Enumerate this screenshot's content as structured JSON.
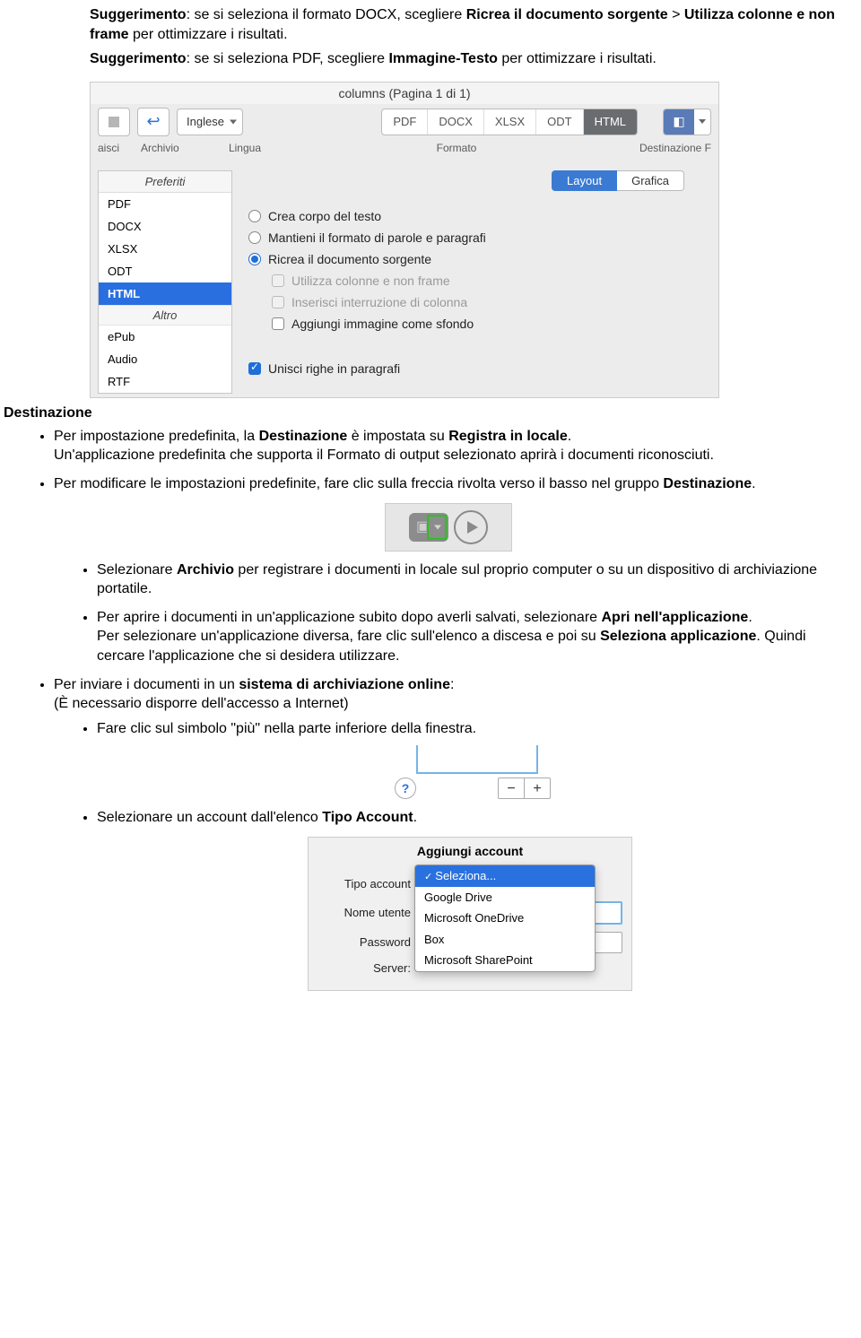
{
  "tips": {
    "tip1_label": "Suggerimento",
    "tip1_part1": ": se si seleziona il formato DOCX, scegliere ",
    "tip1_bold1": "Ricrea il documento sorgente",
    "tip1_part2": " > ",
    "tip1_bold2": "Utilizza colonne e non frame",
    "tip1_part3": " per ottimizzare i risultati.",
    "tip2_label": "Suggerimento",
    "tip2_part1": ": se si seleziona PDF, scegliere ",
    "tip2_bold1": "Immagine-Testo",
    "tip2_part2": " per ottimizzare i risultati."
  },
  "shot1": {
    "title": "columns (Pagina 1 di 1)",
    "lang": "Inglese",
    "formats": [
      "PDF",
      "DOCX",
      "XLSX",
      "ODT",
      "HTML"
    ],
    "selectedFormat": "HTML",
    "toolbarLabels": {
      "aisci": "aisci",
      "archivio": "Archivio",
      "lingua": "Lingua",
      "formato": "Formato",
      "destinazione": "Destinazione  F"
    },
    "favHeader": "Preferiti",
    "favItems": [
      "PDF",
      "DOCX",
      "XLSX",
      "ODT",
      "HTML"
    ],
    "favSubHeader": "Altro",
    "favMore": [
      "ePub",
      "Audio",
      "RTF"
    ],
    "tabLayout": "Layout",
    "tabGrafica": "Grafica",
    "optCreateBody": "Crea corpo del testo",
    "optKeepFmt": "Mantieni il formato di parole e paragrafi",
    "optRicrea": "Ricrea il documento sorgente",
    "chkCols": "Utilizza colonne e non frame",
    "chkColBreak": "Inserisci interruzione di colonna",
    "chkBgImg": "Aggiungi immagine come sfondo",
    "chkMerge": "Unisci righe in paragrafi"
  },
  "dest": {
    "heading": "Destinazione",
    "bullet1_a": "Per impostazione predefinita, la ",
    "bullet1_bold1": "Destinazione",
    "bullet1_b": " è impostata su ",
    "bullet1_bold2": "Registra in locale",
    "bullet1_c": ".",
    "bullet1_line2": "Un'applicazione predefinita che supporta il Formato di output selezionato aprirà i documenti riconosciuti.",
    "bullet2_a": "Per modificare le impostazioni predefinite, fare clic sulla freccia rivolta verso il basso nel gruppo ",
    "bullet2_bold": "Destinazione",
    "bullet2_b": ".",
    "sub1_a": "Selezionare ",
    "sub1_bold": "Archivio",
    "sub1_b": " per registrare i documenti in locale sul proprio computer o su un dispositivo di archiviazione portatile.",
    "sub2_a": "Per aprire i documenti in un'applicazione subito dopo averli salvati, selezionare ",
    "sub2_bold": "Apri nell'applicazione",
    "sub2_b": ".",
    "sub2_line2_a": "Per selezionare un'applicazione diversa, fare clic sull'elenco a discesa e poi su ",
    "sub2_line2_bold": "Seleziona applicazione",
    "sub2_line2_b": ". Quindi cercare l'applicazione che si desidera utilizzare.",
    "bullet3_a": "Per inviare i documenti in un ",
    "bullet3_bold": "sistema di archiviazione online",
    "bullet3_b": ":",
    "bullet3_line2": "(È necessario disporre dell'accesso a Internet)",
    "sub3_1": "Fare clic sul simbolo \"più\" nella parte inferiore della finestra.",
    "sub3_2_a": "Selezionare un account dall'elenco ",
    "sub3_2_bold": "Tipo Account",
    "sub3_2_b": "."
  },
  "shot3": {
    "help": "?",
    "minus": "−",
    "plus": "+"
  },
  "shot4": {
    "title": "Aggiungi account",
    "lblTipo": "Tipo account",
    "lblNome": "Nome utente",
    "lblPass": "Password",
    "lblServer": "Server:",
    "optSel": "Seleziona...",
    "opt1": "Google Drive",
    "opt2": "Microsoft OneDrive",
    "opt3": "Box",
    "opt4": "Microsoft SharePoint"
  }
}
